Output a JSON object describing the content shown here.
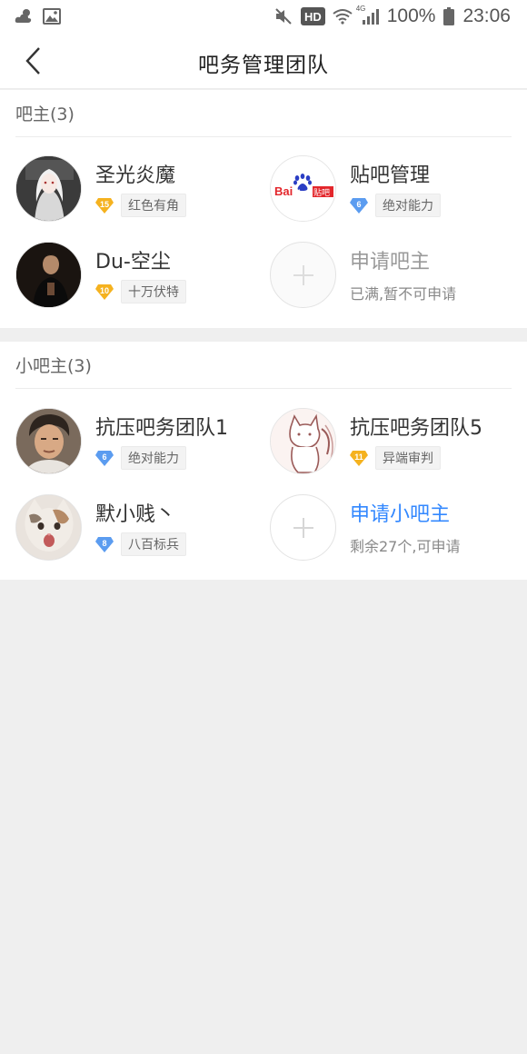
{
  "status_bar": {
    "hd_label": "HD",
    "network_label": "4G",
    "battery_percent": "100%",
    "time": "23:06",
    "icons": [
      "weather-cloud-icon",
      "gallery-icon",
      "mute-icon",
      "wifi-icon",
      "signal-icon",
      "battery-icon"
    ]
  },
  "header": {
    "title": "吧务管理团队"
  },
  "owners": {
    "heading": "吧主(3)",
    "members": [
      {
        "name": "圣光炎魔",
        "level": "15",
        "gem_color": "#f5b21f",
        "title": "红色有角"
      },
      {
        "name": "贴吧管理",
        "level": "6",
        "gem_color": "#5b9cf0",
        "title": "绝对能力"
      },
      {
        "name": "Du-空尘",
        "level": "10",
        "gem_color": "#f5b21f",
        "title": "十万伏特"
      }
    ],
    "apply": {
      "label": "申请吧主",
      "hint": "已满,暂不可申请"
    }
  },
  "junior": {
    "heading": "小吧主(3)",
    "members": [
      {
        "name": "抗压吧务团队1",
        "level": "6",
        "gem_color": "#5b9cf0",
        "title": "绝对能力"
      },
      {
        "name": "抗压吧务团队5",
        "level": "11",
        "gem_color": "#f5b21f",
        "title": "异端审判"
      },
      {
        "name": "默小贱丶",
        "level": "8",
        "gem_color": "#5b9cf0",
        "title": "八百标兵"
      }
    ],
    "apply": {
      "label": "申请小吧主",
      "hint": "剩余27个,可申请"
    }
  },
  "colors": {
    "accent_blue": "#3388ff",
    "baidu_red": "#e3262b",
    "baidu_blue": "#2b3ec4"
  }
}
